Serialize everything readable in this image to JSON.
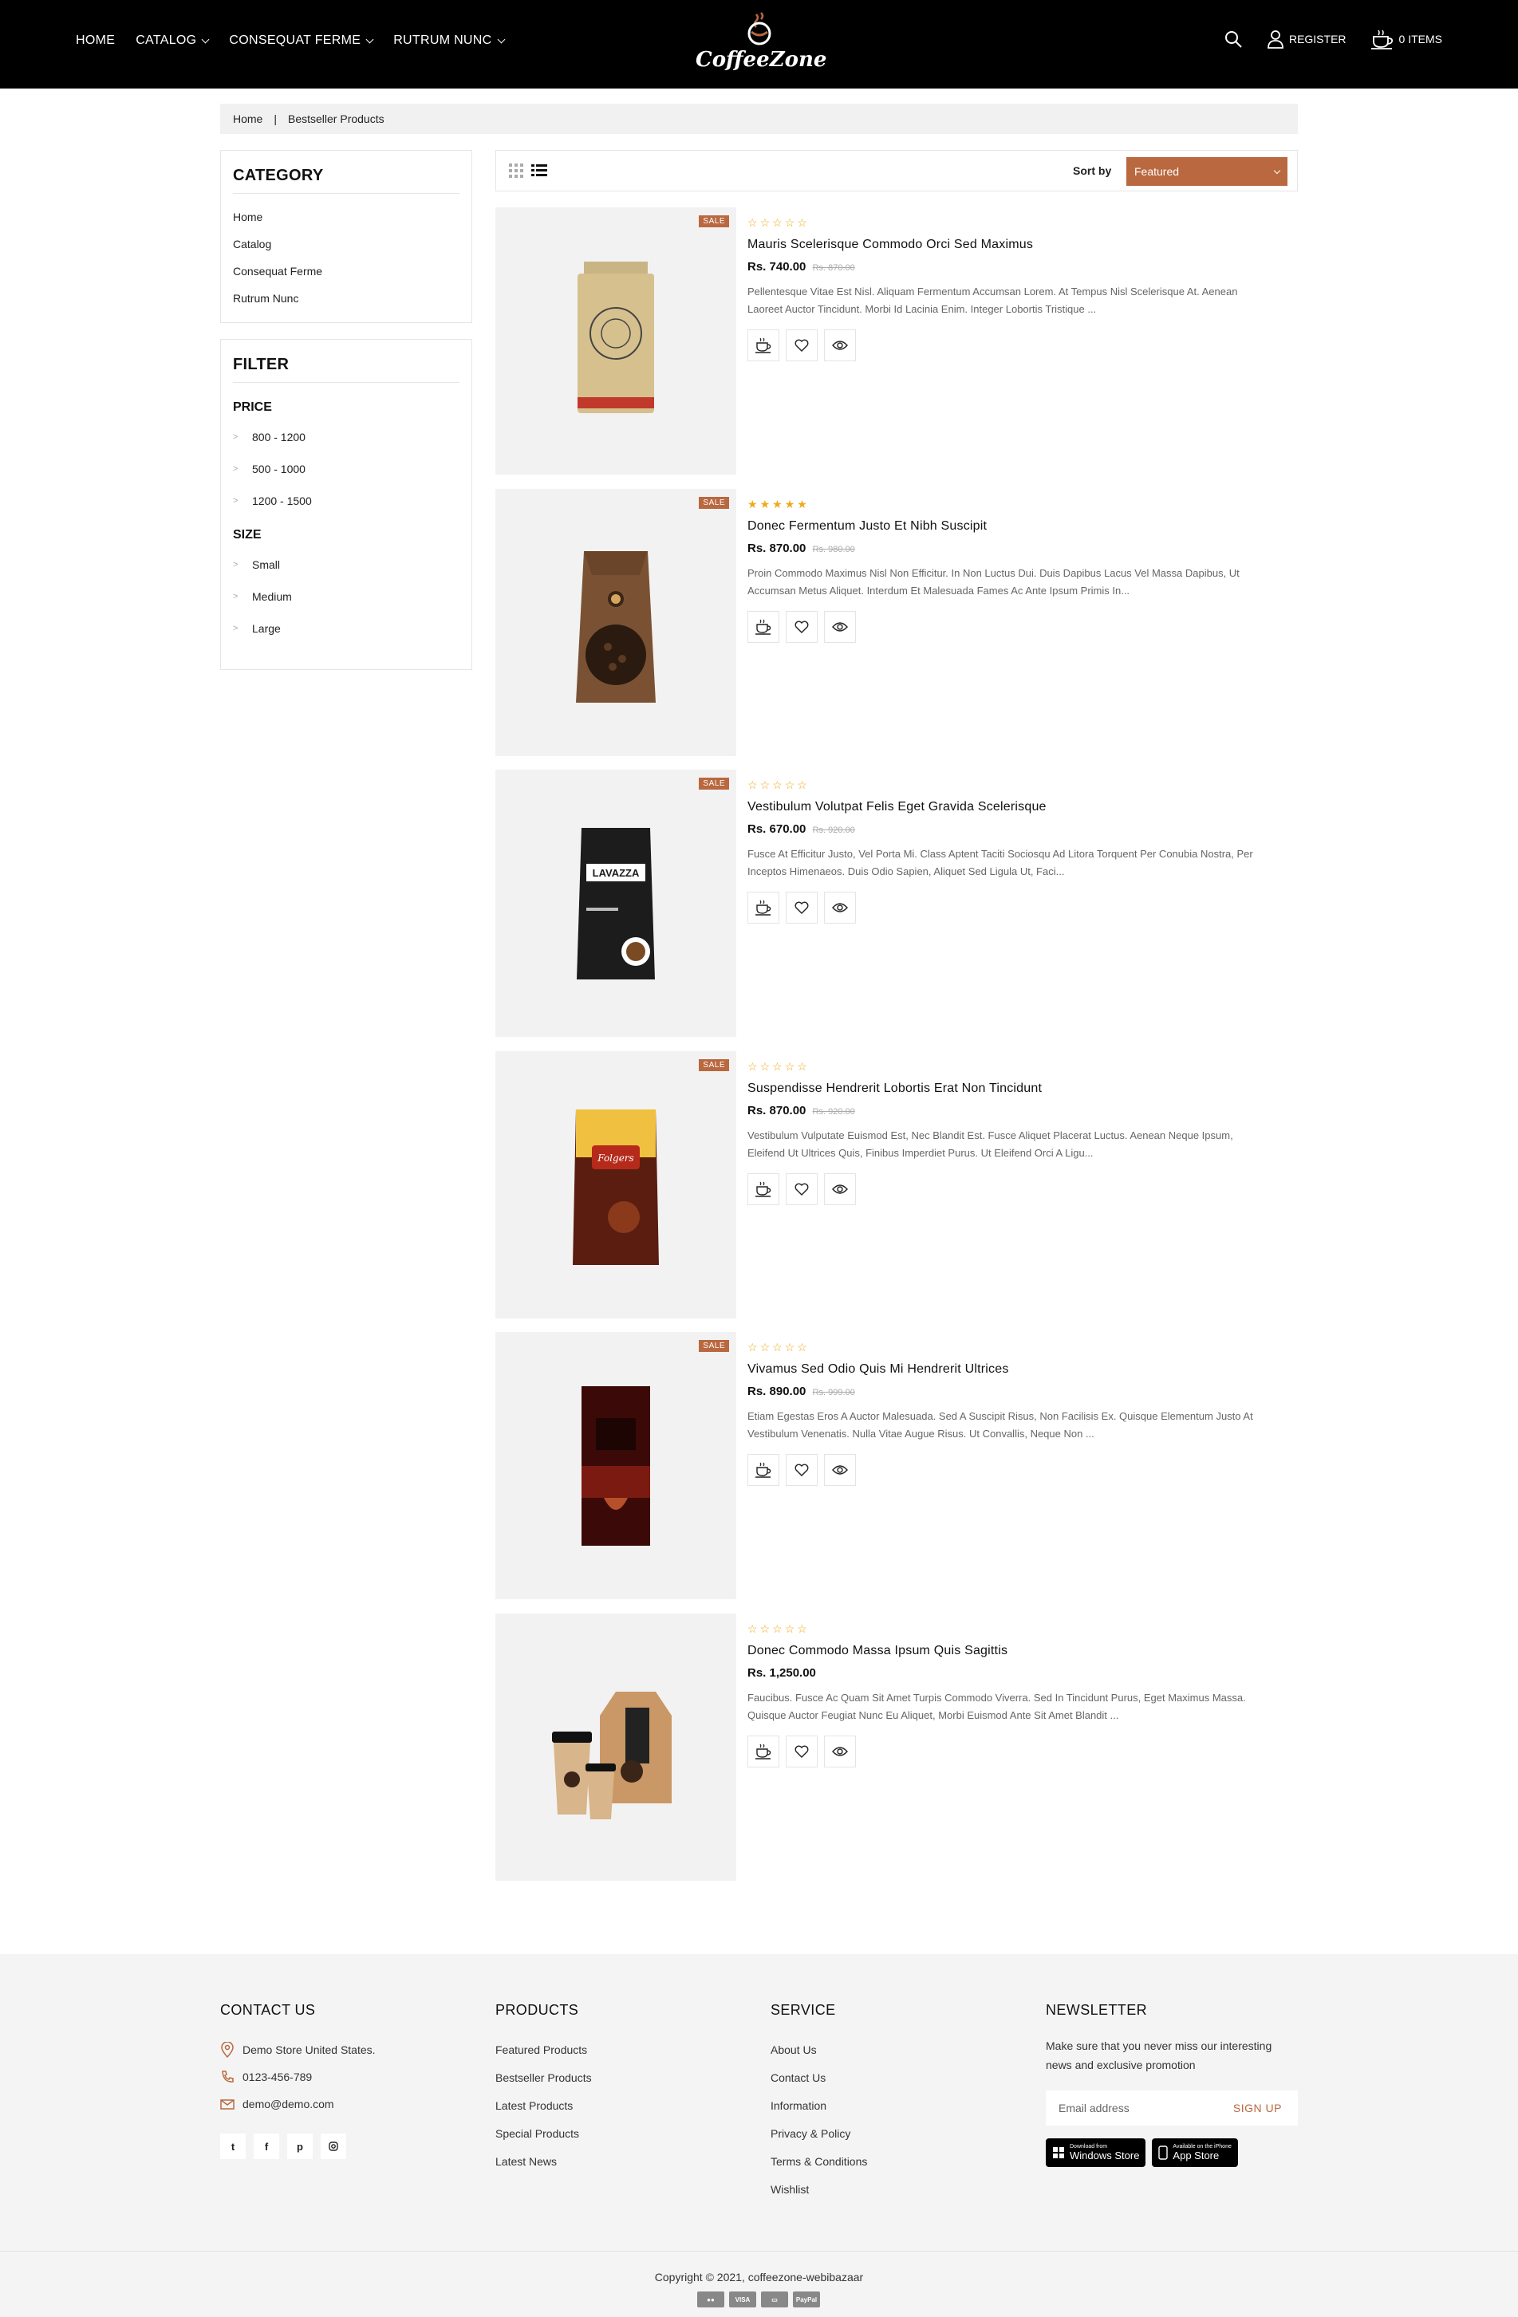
{
  "header": {
    "nav": [
      {
        "label": "HOME",
        "dropdown": false
      },
      {
        "label": "CATALOG",
        "dropdown": true
      },
      {
        "label": "CONSEQUAT FERME",
        "dropdown": true
      },
      {
        "label": "RUTRUM NUNC",
        "dropdown": true
      }
    ],
    "logo_text": "CoffeeZone",
    "register_label": "REGISTER",
    "cart_label": "0 ITEMS"
  },
  "breadcrumb": {
    "home": "Home",
    "current": "Bestseller Products"
  },
  "sidebar": {
    "category_title": "CATEGORY",
    "categories": [
      "Home",
      "Catalog",
      "Consequat Ferme",
      "Rutrum Nunc"
    ],
    "filter_title": "FILTER",
    "price_title": "PRICE",
    "prices": [
      "800 - 1200",
      "500 - 1000",
      "1200 - 1500"
    ],
    "size_title": "SIZE",
    "sizes": [
      "Small",
      "Medium",
      "Large"
    ]
  },
  "toolbar": {
    "sort_label": "Sort by",
    "sort_value": "Featured"
  },
  "colors": {
    "accent": "#b9683f",
    "star": "#f1a916",
    "header_bg": "#000000"
  },
  "products": [
    {
      "name": "Mauris Scelerisque Commodo Orci Sed Maximus",
      "price": "Rs. 740.00",
      "old_price": "Rs. 870.00",
      "sale": "SALE",
      "rating": 0,
      "desc": "Pellentesque Vitae Est Nisl. Aliquam Fermentum Accumsan Lorem. At Tempus Nisl Scelerisque At. Aenean Laoreet Auctor Tincidunt. Morbi Id Lacinia Enim. Integer Lobortis Tristique ...",
      "image": "kraft-bag"
    },
    {
      "name": "Donec Fermentum Justo Et Nibh Suscipit",
      "price": "Rs. 870.00",
      "old_price": "Rs. 980.00",
      "sale": "SALE",
      "rating": 5,
      "desc": "Proin Commodo Maximus Nisl Non Efficitur. In Non Luctus Dui. Duis Dapibus Lacus Vel Massa Dapibus, Ut Accumsan Metus Aliquet. Interdum Et Malesuada Fames Ac Ante Ipsum Primis In...",
      "image": "brown-bag"
    },
    {
      "name": "Vestibulum Volutpat Felis Eget Gravida Scelerisque",
      "price": "Rs. 670.00",
      "old_price": "Rs. 920.00",
      "sale": "SALE",
      "rating": 0,
      "desc": "Fusce At Efficitur Justo, Vel Porta Mi. Class Aptent Taciti Sociosqu Ad Litora Torquent Per Conubia Nostra, Per Inceptos Himenaeos. Duis Odio Sapien, Aliquet Sed Ligula Ut, Faci...",
      "image": "lavazza-bag"
    },
    {
      "name": "Suspendisse Hendrerit Lobortis Erat Non Tincidunt",
      "price": "Rs. 870.00",
      "old_price": "Rs. 920.00",
      "sale": "SALE",
      "rating": 0,
      "desc": "Vestibulum Vulputate Euismod Est, Nec Blandit Est. Fusce Aliquet Placerat Luctus. Aenean Neque Ipsum, Eleifend Ut Ultrices Quis, Finibus Imperdiet Purus. Ut Eleifend Orci A Ligu...",
      "image": "folgers-bag"
    },
    {
      "name": "Vivamus Sed Odio Quis Mi Hendrerit Ultrices",
      "price": "Rs. 890.00",
      "old_price": "Rs. 999.00",
      "sale": "SALE",
      "rating": 0,
      "desc": "Etiam Egestas Eros A Auctor Malesuada. Sed A Suscipit Risus, Non Facilisis Ex. Quisque Elementum Justo At Vestibulum Venenatis. Nulla Vitae Augue Risus. Ut Convallis, Neque Non ...",
      "image": "red-bag"
    },
    {
      "name": "Donec Commodo Massa Ipsum Quis Sagittis",
      "price": "Rs. 1,250.00",
      "old_price": "",
      "sale": "",
      "rating": 0,
      "desc": "Faucibus. Fusce Ac Quam Sit Amet Turpis Commodo Viverra. Sed In Tincidunt Purus, Eget Maximus Massa. Quisque Auctor Feugiat Nunc Eu Aliquet, Morbi Euismod Ante Sit Amet Blandit ...",
      "image": "cups-and-bag"
    }
  ],
  "footer": {
    "contact_title": "CONTACT US",
    "address": "Demo Store United States.",
    "phone": "0123-456-789",
    "email": "demo@demo.com",
    "social": [
      "twitter-icon",
      "facebook-icon",
      "pinterest-icon",
      "instagram-icon"
    ],
    "products_title": "PRODUCTS",
    "products_links": [
      "Featured Products",
      "Bestseller Products",
      "Latest Products",
      "Special Products",
      "Latest News"
    ],
    "service_title": "SERVICE",
    "service_links": [
      "About Us",
      "Contact Us",
      "Information",
      "Privacy & Policy",
      "Terms & Conditions",
      "Wishlist"
    ],
    "newsletter_title": "NEWSLETTER",
    "newsletter_text": "Make sure that you never miss our interesting news and exclusive promotion",
    "email_placeholder": "Email address",
    "signup_label": "SIGN UP",
    "windows_store_small": "Download from",
    "windows_store_big": "Windows Store",
    "app_store_small": "Available on the iPhone",
    "app_store_big": "App Store",
    "copyright": "Copyright © 2021, coffeezone-webibazaar",
    "payments": [
      "mastercard",
      "VISA",
      "card",
      "PayPal"
    ]
  }
}
